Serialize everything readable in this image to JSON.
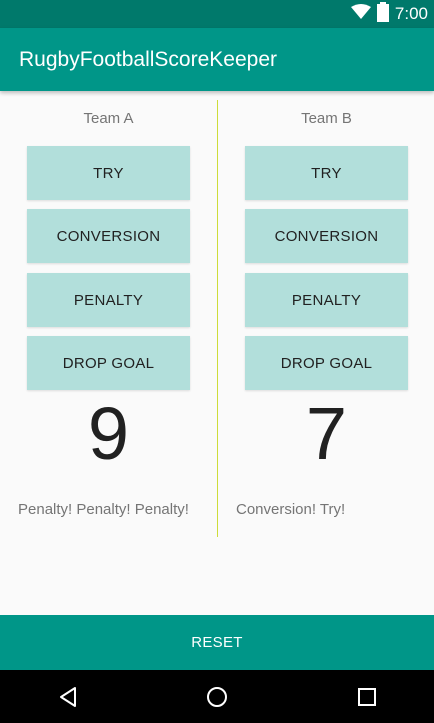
{
  "status_bar": {
    "time": "7:00",
    "icons": [
      "wifi-icon",
      "battery-icon"
    ]
  },
  "app_bar": {
    "title": "RugbyFootballScoreKeeper"
  },
  "teams": [
    {
      "name": "Team A",
      "buttons": {
        "try": "TRY",
        "conversion": "CONVERSION",
        "penalty": "PENALTY",
        "drop_goal": "DROP GOAL"
      },
      "score": "9",
      "history": "Penalty! Penalty! Penalty!"
    },
    {
      "name": "Team B",
      "buttons": {
        "try": "TRY",
        "conversion": "CONVERSION",
        "penalty": "PENALTY",
        "drop_goal": "DROP GOAL"
      },
      "score": "7",
      "history": "Conversion! Try!"
    }
  ],
  "reset_label": "RESET",
  "nav_bar": {
    "icons": [
      "back-icon",
      "home-icon",
      "recents-icon"
    ]
  },
  "colors": {
    "primary": "#009688",
    "primary_dark": "#00796b",
    "button_bg": "#b2dfdb",
    "divider": "#cddc39"
  }
}
